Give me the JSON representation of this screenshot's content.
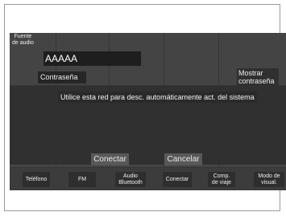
{
  "screen": {
    "audio_source_label": "Fuente\nde audio"
  },
  "network_dialog": {
    "ssid_value": "AAAAA",
    "password_label": "Contraseña",
    "show_password_label": "Mostrar\ncontraseña",
    "auto_connect_text": "Utilice esta red para desc. automáticamente act. del sistema",
    "connect_button": "Conectar",
    "cancel_button": "Cancelar"
  },
  "bottom_nav": {
    "items": [
      {
        "label": "Teléfono"
      },
      {
        "label": "FM"
      },
      {
        "label": "Audio\nBluetooth"
      },
      {
        "label": "Conectar"
      },
      {
        "label": "Comp.\nde viaje"
      },
      {
        "label": "Modo de\nvisual."
      }
    ]
  },
  "colors": {
    "screen_background": "#3c3c3c",
    "text": "#ffffff"
  }
}
